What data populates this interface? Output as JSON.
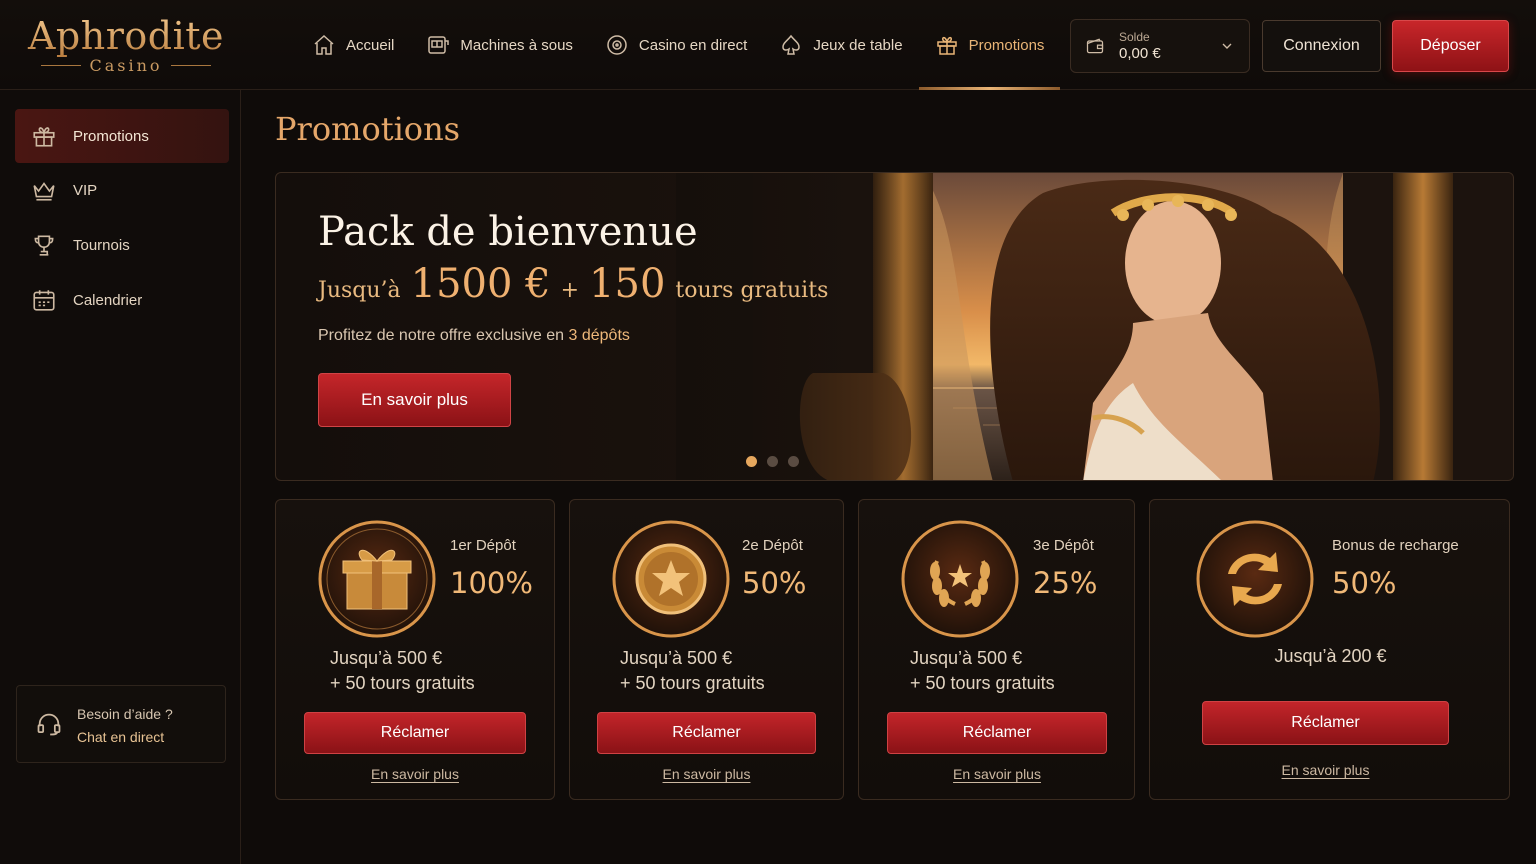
{
  "brand": {
    "name": "Aphrodite",
    "sub": "Casino"
  },
  "nav": {
    "items": [
      {
        "label": "Accueil",
        "icon": "home-icon"
      },
      {
        "label": "Machines à sous",
        "icon": "slot-machine-icon"
      },
      {
        "label": "Casino en direct",
        "icon": "roulette-icon"
      },
      {
        "label": "Jeux de table",
        "icon": "spade-icon"
      },
      {
        "label": "Promotions",
        "icon": "gift-icon",
        "active": true
      }
    ]
  },
  "account": {
    "balance_label": "Solde",
    "balance_value": "0,00 €",
    "login_label": "Connexion",
    "deposit_label": "Déposer"
  },
  "sidebar": {
    "items": [
      {
        "label": "Promotions",
        "icon": "gift-icon",
        "active": true
      },
      {
        "label": "VIP",
        "icon": "crown-icon"
      },
      {
        "label": "Tournois",
        "icon": "trophy-icon"
      },
      {
        "label": "Calendrier",
        "icon": "calendar-icon"
      }
    ],
    "help": {
      "title": "Besoin d’aide ?",
      "link": "Chat en direct",
      "icon": "headset-icon"
    }
  },
  "page": {
    "title": "Promotions"
  },
  "hero": {
    "title": "Pack de bienvenue",
    "prefix": "Jusqu’à",
    "amount": "1500 €",
    "plus": "+",
    "spins": "150",
    "spins_label": "tours gratuits",
    "desc_pre": "Profitez de notre offre exclusive en",
    "desc_highlight": "3 dépôts",
    "button": "En savoir plus",
    "slides": 3,
    "active_slide": 1
  },
  "cards": [
    {
      "label": "1er Dépôt",
      "percent": "100%",
      "line1": "Jusqu’à 500 €",
      "line2": "+ 50 tours gratuits",
      "button": "Réclamer",
      "link": "En savoir plus",
      "icon": "gift-box-icon"
    },
    {
      "label": "2e Dépôt",
      "percent": "50%",
      "line1": "Jusqu’à 500 €",
      "line2": "+ 50 tours gratuits",
      "button": "Réclamer",
      "link": "En savoir plus",
      "icon": "star-coin-icon"
    },
    {
      "label": "3e Dépôt",
      "percent": "25%",
      "line1": "Jusqu’à 500 €",
      "line2": "+ 50 tours gratuits",
      "button": "Réclamer",
      "link": "En savoir plus",
      "icon": "laurel-star-icon"
    },
    {
      "label": "Bonus de recharge",
      "percent": "50%",
      "line1": "Jusqu’à 200 €",
      "line2": "",
      "button": "Réclamer",
      "link": "En savoir plus",
      "icon": "refresh-icon"
    }
  ],
  "colors": {
    "accent_gold": "#e9b476",
    "cta_red": "#c3252a",
    "background": "#0f0b09"
  }
}
